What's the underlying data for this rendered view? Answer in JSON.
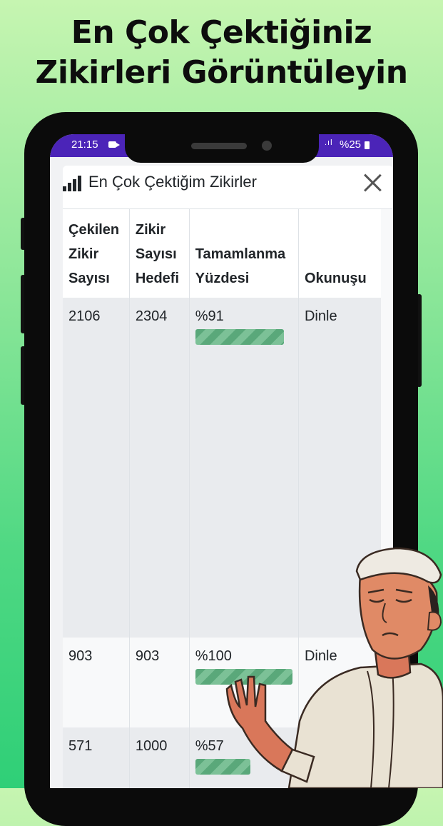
{
  "promo": {
    "line1": "En  Çok Çektiğiniz",
    "line2": "Zikirleri Görüntüleyin"
  },
  "statusbar": {
    "time": "21:15",
    "battery": "%25",
    "signal": ".ıl"
  },
  "modal": {
    "title": "En Çok Çektiğim Zikirler",
    "title_icon": "bar-chart-icon",
    "close_icon": "close-icon"
  },
  "table": {
    "headers": {
      "count": [
        "Çekilen",
        "Zikir",
        "Sayısı"
      ],
      "target": [
        "Zikir",
        "Sayısı",
        "Hedefi"
      ],
      "percent": [
        "Tamamlanma",
        "Yüzdesi"
      ],
      "listen": "Okunuşu"
    },
    "rows": [
      {
        "count": "2106",
        "target": "2304",
        "percent_label": "%91",
        "percent": 0.91,
        "listen": "Dinle"
      },
      {
        "count": "903",
        "target": "903",
        "percent_label": "%100",
        "percent": 1.0,
        "listen": "Dinle"
      },
      {
        "count": "571",
        "target": "1000",
        "percent_label": "%57",
        "percent": 0.57,
        "listen": ""
      }
    ]
  },
  "colors": {
    "statusbar": "#4b24b8",
    "progress": "#5aa87a",
    "row_shade": "#e9ebee"
  }
}
